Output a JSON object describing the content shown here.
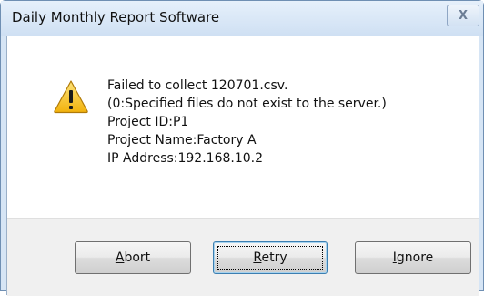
{
  "window": {
    "title": "Daily Monthly Report Software",
    "close_symbol": "X"
  },
  "message": {
    "icon": "warning-icon",
    "lines": [
      "Failed to collect 120701.csv.",
      "(0:Specified files do not exist to the server.)",
      "Project ID:P1",
      "Project Name:Factory A",
      "IP Address:192.168.10.2"
    ]
  },
  "buttons": {
    "abort": {
      "mnemonic": "A",
      "rest": "bort"
    },
    "retry": {
      "mnemonic": "R",
      "rest": "etry"
    },
    "ignore": {
      "mnemonic": "I",
      "rest": "gnore"
    }
  },
  "colors": {
    "frame": "#d6e5f5",
    "warning_fill": "#f7c51e",
    "default_button_border": "#3c7fb1"
  }
}
